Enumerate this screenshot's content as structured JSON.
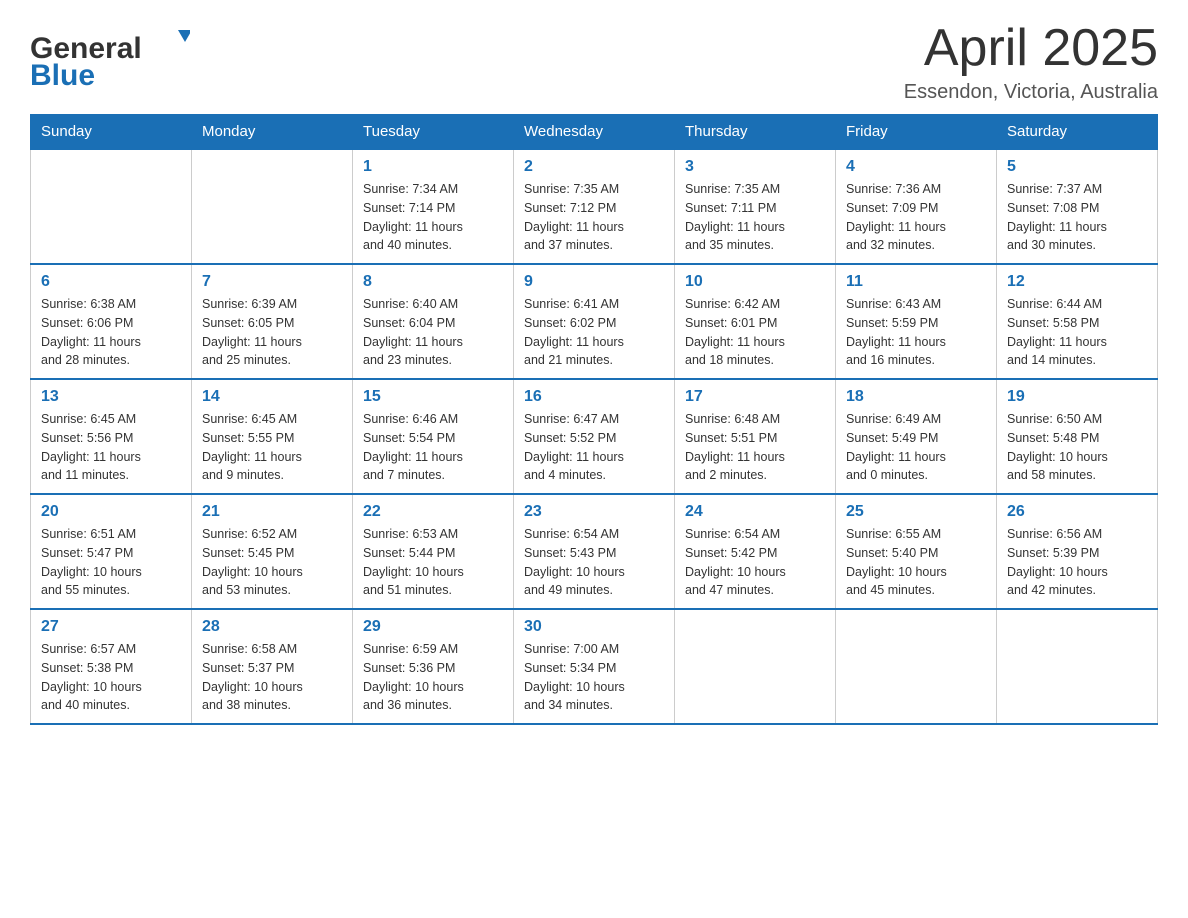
{
  "header": {
    "logo_general": "General",
    "logo_blue": "Blue",
    "month_title": "April 2025",
    "location": "Essendon, Victoria, Australia"
  },
  "days_of_week": [
    "Sunday",
    "Monday",
    "Tuesday",
    "Wednesday",
    "Thursday",
    "Friday",
    "Saturday"
  ],
  "weeks": [
    [
      {
        "day": "",
        "info": ""
      },
      {
        "day": "",
        "info": ""
      },
      {
        "day": "1",
        "info": "Sunrise: 7:34 AM\nSunset: 7:14 PM\nDaylight: 11 hours\nand 40 minutes."
      },
      {
        "day": "2",
        "info": "Sunrise: 7:35 AM\nSunset: 7:12 PM\nDaylight: 11 hours\nand 37 minutes."
      },
      {
        "day": "3",
        "info": "Sunrise: 7:35 AM\nSunset: 7:11 PM\nDaylight: 11 hours\nand 35 minutes."
      },
      {
        "day": "4",
        "info": "Sunrise: 7:36 AM\nSunset: 7:09 PM\nDaylight: 11 hours\nand 32 minutes."
      },
      {
        "day": "5",
        "info": "Sunrise: 7:37 AM\nSunset: 7:08 PM\nDaylight: 11 hours\nand 30 minutes."
      }
    ],
    [
      {
        "day": "6",
        "info": "Sunrise: 6:38 AM\nSunset: 6:06 PM\nDaylight: 11 hours\nand 28 minutes."
      },
      {
        "day": "7",
        "info": "Sunrise: 6:39 AM\nSunset: 6:05 PM\nDaylight: 11 hours\nand 25 minutes."
      },
      {
        "day": "8",
        "info": "Sunrise: 6:40 AM\nSunset: 6:04 PM\nDaylight: 11 hours\nand 23 minutes."
      },
      {
        "day": "9",
        "info": "Sunrise: 6:41 AM\nSunset: 6:02 PM\nDaylight: 11 hours\nand 21 minutes."
      },
      {
        "day": "10",
        "info": "Sunrise: 6:42 AM\nSunset: 6:01 PM\nDaylight: 11 hours\nand 18 minutes."
      },
      {
        "day": "11",
        "info": "Sunrise: 6:43 AM\nSunset: 5:59 PM\nDaylight: 11 hours\nand 16 minutes."
      },
      {
        "day": "12",
        "info": "Sunrise: 6:44 AM\nSunset: 5:58 PM\nDaylight: 11 hours\nand 14 minutes."
      }
    ],
    [
      {
        "day": "13",
        "info": "Sunrise: 6:45 AM\nSunset: 5:56 PM\nDaylight: 11 hours\nand 11 minutes."
      },
      {
        "day": "14",
        "info": "Sunrise: 6:45 AM\nSunset: 5:55 PM\nDaylight: 11 hours\nand 9 minutes."
      },
      {
        "day": "15",
        "info": "Sunrise: 6:46 AM\nSunset: 5:54 PM\nDaylight: 11 hours\nand 7 minutes."
      },
      {
        "day": "16",
        "info": "Sunrise: 6:47 AM\nSunset: 5:52 PM\nDaylight: 11 hours\nand 4 minutes."
      },
      {
        "day": "17",
        "info": "Sunrise: 6:48 AM\nSunset: 5:51 PM\nDaylight: 11 hours\nand 2 minutes."
      },
      {
        "day": "18",
        "info": "Sunrise: 6:49 AM\nSunset: 5:49 PM\nDaylight: 11 hours\nand 0 minutes."
      },
      {
        "day": "19",
        "info": "Sunrise: 6:50 AM\nSunset: 5:48 PM\nDaylight: 10 hours\nand 58 minutes."
      }
    ],
    [
      {
        "day": "20",
        "info": "Sunrise: 6:51 AM\nSunset: 5:47 PM\nDaylight: 10 hours\nand 55 minutes."
      },
      {
        "day": "21",
        "info": "Sunrise: 6:52 AM\nSunset: 5:45 PM\nDaylight: 10 hours\nand 53 minutes."
      },
      {
        "day": "22",
        "info": "Sunrise: 6:53 AM\nSunset: 5:44 PM\nDaylight: 10 hours\nand 51 minutes."
      },
      {
        "day": "23",
        "info": "Sunrise: 6:54 AM\nSunset: 5:43 PM\nDaylight: 10 hours\nand 49 minutes."
      },
      {
        "day": "24",
        "info": "Sunrise: 6:54 AM\nSunset: 5:42 PM\nDaylight: 10 hours\nand 47 minutes."
      },
      {
        "day": "25",
        "info": "Sunrise: 6:55 AM\nSunset: 5:40 PM\nDaylight: 10 hours\nand 45 minutes."
      },
      {
        "day": "26",
        "info": "Sunrise: 6:56 AM\nSunset: 5:39 PM\nDaylight: 10 hours\nand 42 minutes."
      }
    ],
    [
      {
        "day": "27",
        "info": "Sunrise: 6:57 AM\nSunset: 5:38 PM\nDaylight: 10 hours\nand 40 minutes."
      },
      {
        "day": "28",
        "info": "Sunrise: 6:58 AM\nSunset: 5:37 PM\nDaylight: 10 hours\nand 38 minutes."
      },
      {
        "day": "29",
        "info": "Sunrise: 6:59 AM\nSunset: 5:36 PM\nDaylight: 10 hours\nand 36 minutes."
      },
      {
        "day": "30",
        "info": "Sunrise: 7:00 AM\nSunset: 5:34 PM\nDaylight: 10 hours\nand 34 minutes."
      },
      {
        "day": "",
        "info": ""
      },
      {
        "day": "",
        "info": ""
      },
      {
        "day": "",
        "info": ""
      }
    ]
  ]
}
